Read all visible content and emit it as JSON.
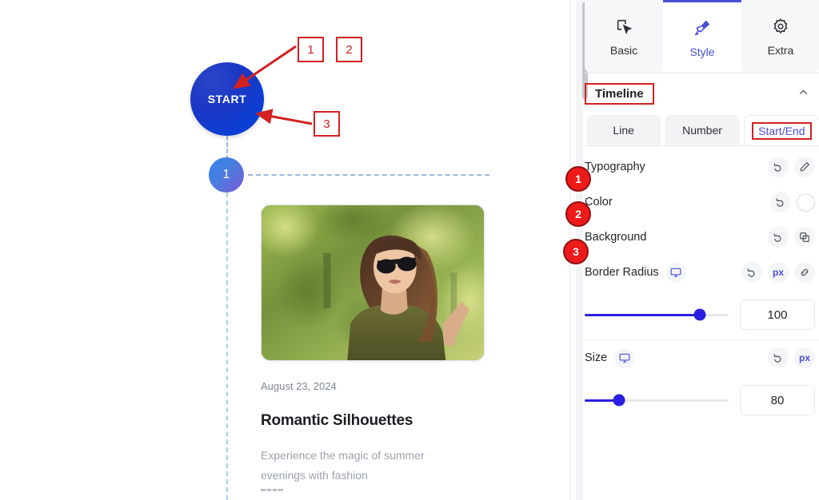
{
  "canvas": {
    "start_button": {
      "label": "START"
    },
    "timeline_marker": {
      "label": "1"
    },
    "card": {
      "date": "August 23, 2024",
      "title": "Romantic Silhouettes",
      "description": "Experience the magic of summer evenings with fashion",
      "image_alt": "woman-with-sunglasses-photo"
    },
    "annotations": [
      {
        "id": "1",
        "label": "1"
      },
      {
        "id": "2",
        "label": "2"
      },
      {
        "id": "3",
        "label": "3"
      }
    ]
  },
  "panel": {
    "tabs": [
      {
        "label": "Basic",
        "icon": "cursor-box-icon",
        "active": false
      },
      {
        "label": "Style",
        "icon": "paintbrush-icon",
        "active": true
      },
      {
        "label": "Extra",
        "icon": "gear-icon",
        "active": false
      }
    ],
    "section": {
      "title": "Timeline",
      "collapse_icon": "chevron-up-icon"
    },
    "subtabs": [
      {
        "label": "Line",
        "active": false
      },
      {
        "label": "Number",
        "active": false
      },
      {
        "label": "Start/End",
        "active": true
      }
    ],
    "rows": [
      {
        "badge": "1",
        "label": "Typography",
        "actions": [
          "reset-icon",
          "pencil-icon"
        ]
      },
      {
        "badge": "2",
        "label": "Color",
        "actions": [
          "reset-icon",
          "color-swatch"
        ]
      },
      {
        "badge": "3",
        "label": "Background",
        "actions": [
          "reset-icon",
          "layers-icon"
        ]
      }
    ],
    "border_radius": {
      "label": "Border Radius",
      "device_icon": "desktop-icon",
      "reset_icon": "reset-icon",
      "unit": "px",
      "link_icon": "link-icon",
      "value": "100",
      "percent": 80
    },
    "size": {
      "label": "Size",
      "device_icon": "desktop-icon",
      "reset_icon": "reset-icon",
      "unit": "px",
      "value": "80",
      "percent": 24
    }
  },
  "colors": {
    "accent": "#4a4fd6",
    "slider": "#2a1fe0",
    "annotation_red": "#d32020",
    "badge_red": "#ee1a1a",
    "start_blue": "#0b3fd4"
  }
}
